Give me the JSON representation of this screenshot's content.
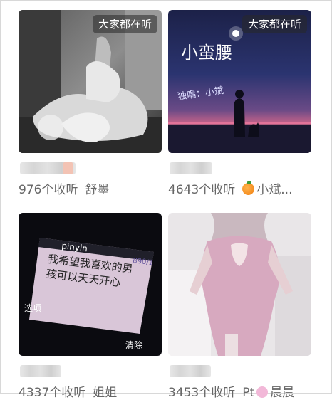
{
  "cards": [
    {
      "badge": "大家都在听",
      "listens": "976个收听",
      "author": "舒墨"
    },
    {
      "badge": "大家都在听",
      "listens": "4643个收听",
      "author": "小斌...",
      "author_icon": "orange-emoji-icon",
      "cover_title": "小蛮腰",
      "cover_subtitle": "独唱：小斌"
    },
    {
      "listens": "4337个收听",
      "author": "姐姐",
      "cover_ime": "pinyin",
      "cover_counter": "890/1",
      "cover_text": "我希望我喜欢的男孩可以天天开心",
      "cover_left_key": "选项",
      "cover_right_key": "清除"
    },
    {
      "listens": "3453个收听",
      "author_prefix": "Pt",
      "author_icon": "unicorn-emoji-icon",
      "author": "晨晨"
    }
  ]
}
